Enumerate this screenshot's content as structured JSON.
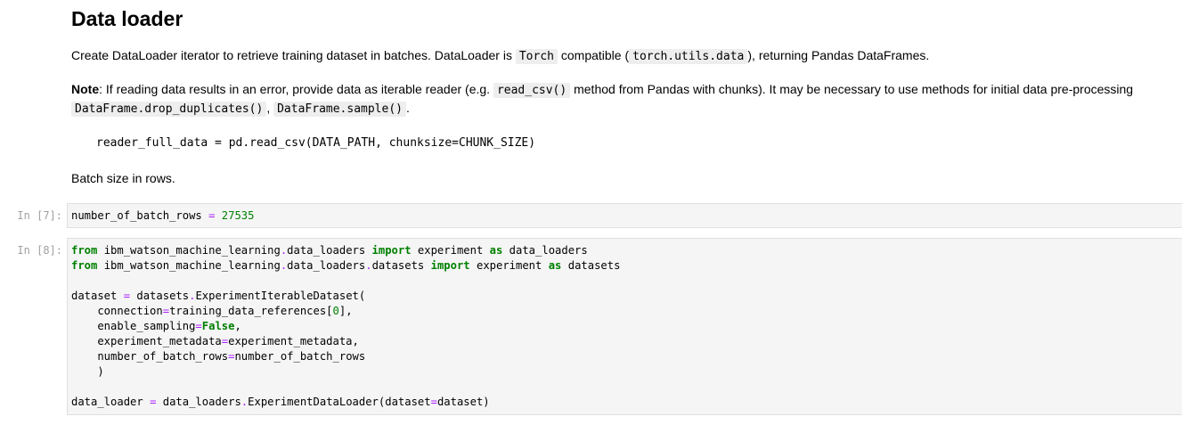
{
  "markdown": {
    "heading": "Data loader",
    "para1": {
      "pre": "Create DataLoader iterator to retrieve training dataset in batches. DataLoader is ",
      "code1": "Torch",
      "mid": " compatible (",
      "code2": "torch.utils.data",
      "post": "), returning Pandas DataFrames."
    },
    "para2": {
      "bold": "Note",
      "pre": ": If reading data results in an error, provide data as iterable reader (e.g. ",
      "code1": "read_csv()",
      "post": " method from Pandas with chunks). It may be necessary to use methods for initial data pre-processing",
      "code2": "DataFrame.drop_duplicates()",
      "sep": ", ",
      "code3": "DataFrame.sample()",
      "end": "."
    },
    "code_block": "reader_full_data = pd.read_csv(DATA_PATH, chunksize=CHUNK_SIZE)",
    "para3": "Batch size in rows."
  },
  "cells": [
    {
      "prompt": "In [7]:",
      "lines": [
        [
          {
            "t": "number_of_batch_rows "
          },
          {
            "t": "=",
            "c": "op"
          },
          {
            "t": " "
          },
          {
            "t": "27535",
            "c": "num"
          }
        ]
      ]
    },
    {
      "prompt": "In [8]:",
      "lines": [
        [
          {
            "t": "from",
            "c": "kw"
          },
          {
            "t": " ibm_watson_machine_learning"
          },
          {
            "t": ".",
            "c": "op"
          },
          {
            "t": "data_loaders "
          },
          {
            "t": "import",
            "c": "kw"
          },
          {
            "t": " experiment "
          },
          {
            "t": "as",
            "c": "kw"
          },
          {
            "t": " data_loaders"
          }
        ],
        [
          {
            "t": "from",
            "c": "kw"
          },
          {
            "t": " ibm_watson_machine_learning"
          },
          {
            "t": ".",
            "c": "op"
          },
          {
            "t": "data_loaders"
          },
          {
            "t": ".",
            "c": "op"
          },
          {
            "t": "datasets "
          },
          {
            "t": "import",
            "c": "kw"
          },
          {
            "t": " experiment "
          },
          {
            "t": "as",
            "c": "kw"
          },
          {
            "t": " datasets"
          }
        ],
        [],
        [
          {
            "t": "dataset "
          },
          {
            "t": "=",
            "c": "op"
          },
          {
            "t": " datasets"
          },
          {
            "t": ".",
            "c": "op"
          },
          {
            "t": "ExperimentIterableDataset("
          }
        ],
        [
          {
            "t": "    connection"
          },
          {
            "t": "=",
            "c": "op"
          },
          {
            "t": "training_data_references["
          },
          {
            "t": "0",
            "c": "num"
          },
          {
            "t": "],"
          }
        ],
        [
          {
            "t": "    enable_sampling"
          },
          {
            "t": "=",
            "c": "op"
          },
          {
            "t": "False",
            "c": "kc"
          },
          {
            "t": ","
          }
        ],
        [
          {
            "t": "    experiment_metadata"
          },
          {
            "t": "=",
            "c": "op"
          },
          {
            "t": "experiment_metadata,"
          }
        ],
        [
          {
            "t": "    number_of_batch_rows"
          },
          {
            "t": "=",
            "c": "op"
          },
          {
            "t": "number_of_batch_rows"
          }
        ],
        [
          {
            "t": "    )"
          }
        ],
        [],
        [
          {
            "t": "data_loader "
          },
          {
            "t": "=",
            "c": "op"
          },
          {
            "t": " data_loaders"
          },
          {
            "t": ".",
            "c": "op"
          },
          {
            "t": "ExperimentDataLoader(dataset"
          },
          {
            "t": "=",
            "c": "op"
          },
          {
            "t": "dataset)"
          }
        ]
      ]
    }
  ]
}
